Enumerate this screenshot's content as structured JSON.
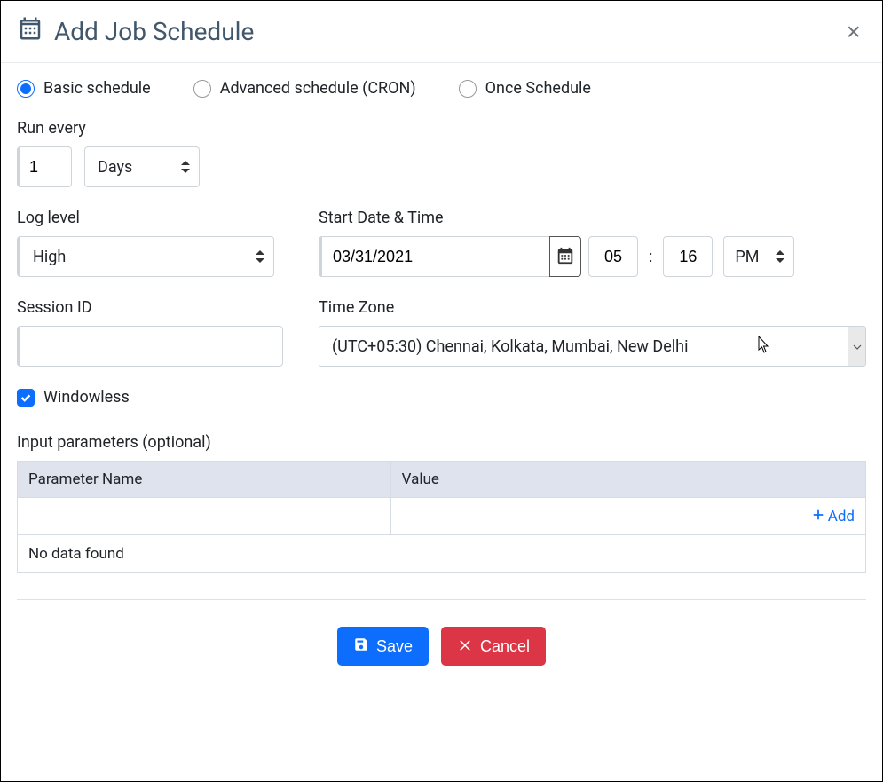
{
  "header": {
    "title": "Add Job Schedule"
  },
  "schedule_types": {
    "basic": "Basic schedule",
    "advanced": "Advanced schedule (CRON)",
    "once": "Once Schedule",
    "selected": "basic"
  },
  "labels": {
    "run_every": "Run every",
    "log_level": "Log level",
    "start_dt": "Start Date & Time",
    "session_id": "Session ID",
    "time_zone": "Time Zone",
    "windowless": "Windowless",
    "params": "Input parameters (optional)"
  },
  "run_every": {
    "value": "1",
    "unit": "Days"
  },
  "log_level": "High",
  "start": {
    "date": "03/31/2021",
    "hour": "05",
    "minute": "16",
    "ampm": "PM",
    "colon": ":"
  },
  "session_id": "",
  "time_zone": "(UTC+05:30) Chennai, Kolkata, Mumbai, New Delhi",
  "windowless_checked": true,
  "params_table": {
    "col_name": "Parameter Name",
    "col_value": "Value",
    "add_label": "Add",
    "empty_text": "No data found"
  },
  "footer": {
    "save": "Save",
    "cancel": "Cancel"
  }
}
